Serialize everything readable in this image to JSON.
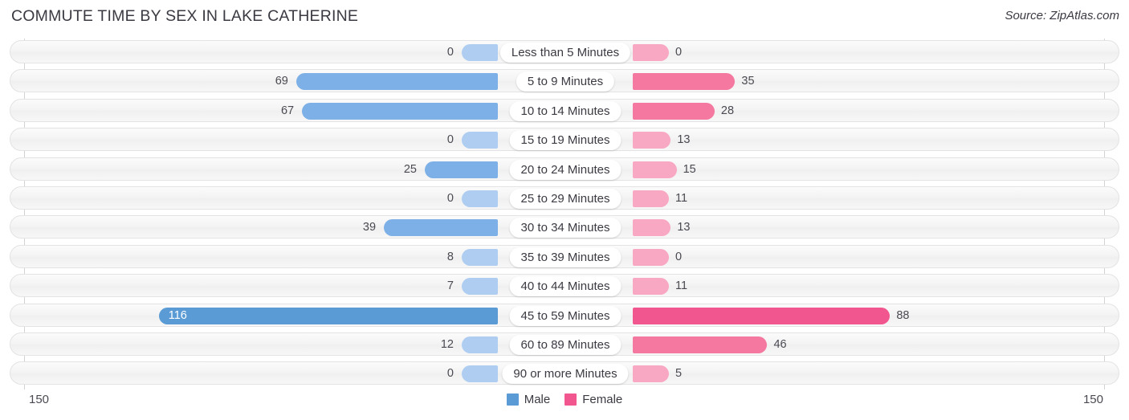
{
  "header": {
    "title": "COMMUTE TIME BY SEX IN LAKE CATHERINE",
    "source": "Source: ZipAtlas.com"
  },
  "axis": {
    "left_tick": "150",
    "right_tick": "150"
  },
  "legend": {
    "items": [
      {
        "label": "Male",
        "color": "#5b9bd5"
      },
      {
        "label": "Female",
        "color": "#f2568f"
      }
    ]
  },
  "colors": {
    "male_max": "#5b9bd5",
    "male_mid": "#7cb0e6",
    "male_low": "#aecdf0",
    "female_max": "#f2568f",
    "female_mid": "#f4789f",
    "female_low": "#f8a8c2",
    "row_background": "#f4f4f4",
    "row_border": "#e3e3e5",
    "text": "#3a3a42"
  },
  "chart_data": {
    "type": "bar",
    "title": "COMMUTE TIME BY SEX IN LAKE CATHERINE",
    "subtitle": "Source: ZipAtlas.com",
    "orientation": "horizontal-diverging",
    "xlabel": "",
    "ylabel": "",
    "xlim": [
      150,
      150
    ],
    "axis_ticks": [
      "150",
      "150"
    ],
    "grid": false,
    "legend_position": "bottom-center",
    "categories": [
      "Less than 5 Minutes",
      "5 to 9 Minutes",
      "10 to 14 Minutes",
      "15 to 19 Minutes",
      "20 to 24 Minutes",
      "25 to 29 Minutes",
      "30 to 34 Minutes",
      "35 to 39 Minutes",
      "40 to 44 Minutes",
      "45 to 59 Minutes",
      "60 to 89 Minutes",
      "90 or more Minutes"
    ],
    "series": [
      {
        "name": "Male",
        "color": "#5b9bd5",
        "values": [
          0,
          69,
          67,
          0,
          25,
          0,
          39,
          8,
          7,
          116,
          12,
          0
        ]
      },
      {
        "name": "Female",
        "color": "#f2568f",
        "values": [
          0,
          35,
          28,
          13,
          15,
          11,
          13,
          0,
          11,
          88,
          46,
          5
        ]
      }
    ]
  },
  "rows": [
    {
      "category": "Less than 5 Minutes",
      "male": "0",
      "female": "0"
    },
    {
      "category": "5 to 9 Minutes",
      "male": "69",
      "female": "35"
    },
    {
      "category": "10 to 14 Minutes",
      "male": "67",
      "female": "28"
    },
    {
      "category": "15 to 19 Minutes",
      "male": "0",
      "female": "13"
    },
    {
      "category": "20 to 24 Minutes",
      "male": "25",
      "female": "15"
    },
    {
      "category": "25 to 29 Minutes",
      "male": "0",
      "female": "11"
    },
    {
      "category": "30 to 34 Minutes",
      "male": "39",
      "female": "13"
    },
    {
      "category": "35 to 39 Minutes",
      "male": "8",
      "female": "0"
    },
    {
      "category": "40 to 44 Minutes",
      "male": "7",
      "female": "11"
    },
    {
      "category": "45 to 59 Minutes",
      "male": "116",
      "female": "88"
    },
    {
      "category": "60 to 89 Minutes",
      "male": "12",
      "female": "46"
    },
    {
      "category": "90 or more Minutes",
      "male": "0",
      "female": "5"
    }
  ]
}
